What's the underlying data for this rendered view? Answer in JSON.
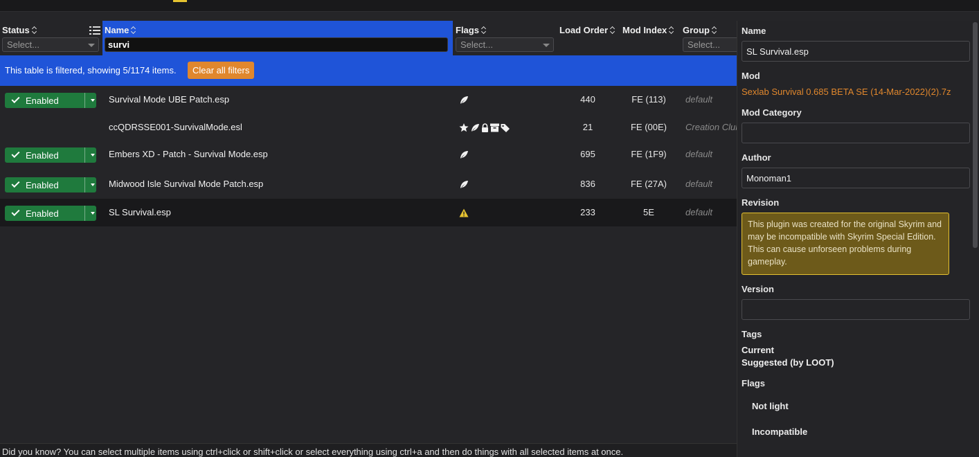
{
  "headers": {
    "status": "Status",
    "name": "Name",
    "flags": "Flags",
    "load_order": "Load Order",
    "mod_index": "Mod Index",
    "group": "Group"
  },
  "filters": {
    "status_placeholder": "Select...",
    "name_value": "survi",
    "flags_placeholder": "Select...",
    "group_placeholder": "Select..."
  },
  "filter_notice": {
    "message": "This table is filtered, showing 5/1174 items.",
    "clear_label": "Clear all filters"
  },
  "rows": [
    {
      "status": "Enabled",
      "name": "Survival Mode UBE Patch.esp",
      "flags": [
        "feather"
      ],
      "load_order": "440",
      "mod_index": "FE (113)",
      "group": "default"
    },
    {
      "status": "",
      "name": "ccQDRSSE001-SurvivalMode.esl",
      "flags": [
        "star",
        "feather",
        "lock",
        "archive",
        "tag"
      ],
      "load_order": "21",
      "mod_index": "FE (00E)",
      "group": "Creation Club"
    },
    {
      "status": "Enabled",
      "name": "Embers XD - Patch - Survival Mode.esp",
      "flags": [
        "feather"
      ],
      "load_order": "695",
      "mod_index": "FE (1F9)",
      "group": "default"
    },
    {
      "status": "Enabled",
      "name": "Midwood Isle Survival Mode Patch.esp",
      "flags": [
        "feather"
      ],
      "load_order": "836",
      "mod_index": "FE (27A)",
      "group": "default"
    },
    {
      "status": "Enabled",
      "name": "SL Survival.esp",
      "flags": [
        "warning"
      ],
      "load_order": "233",
      "mod_index": "5E",
      "group": "default"
    }
  ],
  "footer": "Did you know? You can select multiple items using ctrl+click or shift+click or select everything using ctrl+a and then do things with all selected items at once.",
  "details": {
    "name_label": "Name",
    "name_value": "SL Survival.esp",
    "mod_label": "Mod",
    "mod_value": "Sexlab Survival 0.685 BETA SE (14-Mar-2022)(2).7z",
    "category_label": "Mod Category",
    "category_value": "",
    "author_label": "Author",
    "author_value": "Monoman1",
    "revision_label": "Revision",
    "warning": "This plugin was created for the original Skyrim and may be incompatible with Skyrim Special Edition. This can cause unforseen problems during gameplay.",
    "version_label": "Version",
    "version_value": "",
    "tags_label": "Tags",
    "tags_current": "Current",
    "tags_suggested": "Suggested (by LOOT)",
    "flags_label": "Flags",
    "flag_items": [
      "Not light",
      "Incompatible"
    ]
  },
  "colors": {
    "accent_blue": "#1f54d8",
    "enabled_green": "#1f7a3d",
    "orange": "#e0872d",
    "warning_yellow": "#e5c230"
  }
}
